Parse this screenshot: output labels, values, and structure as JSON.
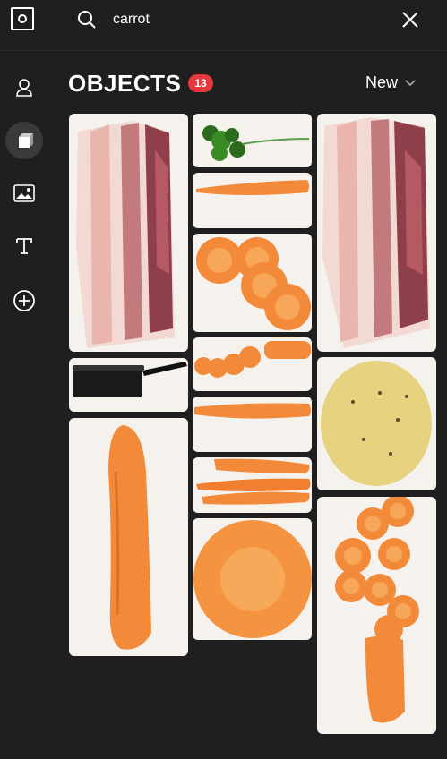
{
  "search": {
    "value": "carrot"
  },
  "header": {
    "title": "OBJECTS",
    "count": "13",
    "sort_label": "New"
  },
  "colors": {
    "badge": "#e5393f",
    "carrot": "#f28a3a",
    "tile_bg": "#f5f2ee"
  },
  "sidebar": {
    "items": [
      {
        "icon": "person-icon"
      },
      {
        "icon": "cube-icon"
      },
      {
        "icon": "image-icon"
      },
      {
        "icon": "text-icon"
      },
      {
        "icon": "plus-circle-icon"
      }
    ]
  },
  "objects": [
    {
      "icon": "bacon-image"
    },
    {
      "icon": "saucepan-image"
    },
    {
      "icon": "carrot-upright-image"
    },
    {
      "icon": "parsley-image"
    },
    {
      "icon": "carrot-horizontal-image"
    },
    {
      "icon": "carrot-slices-image"
    },
    {
      "icon": "carrot-cut-pieces-image"
    },
    {
      "icon": "carrot-whole-image"
    },
    {
      "icon": "carrot-bunch-image"
    },
    {
      "icon": "carrot-round-slice-image"
    },
    {
      "icon": "bacon-image"
    },
    {
      "icon": "potato-image"
    },
    {
      "icon": "carrot-sliced-stack-image"
    }
  ]
}
